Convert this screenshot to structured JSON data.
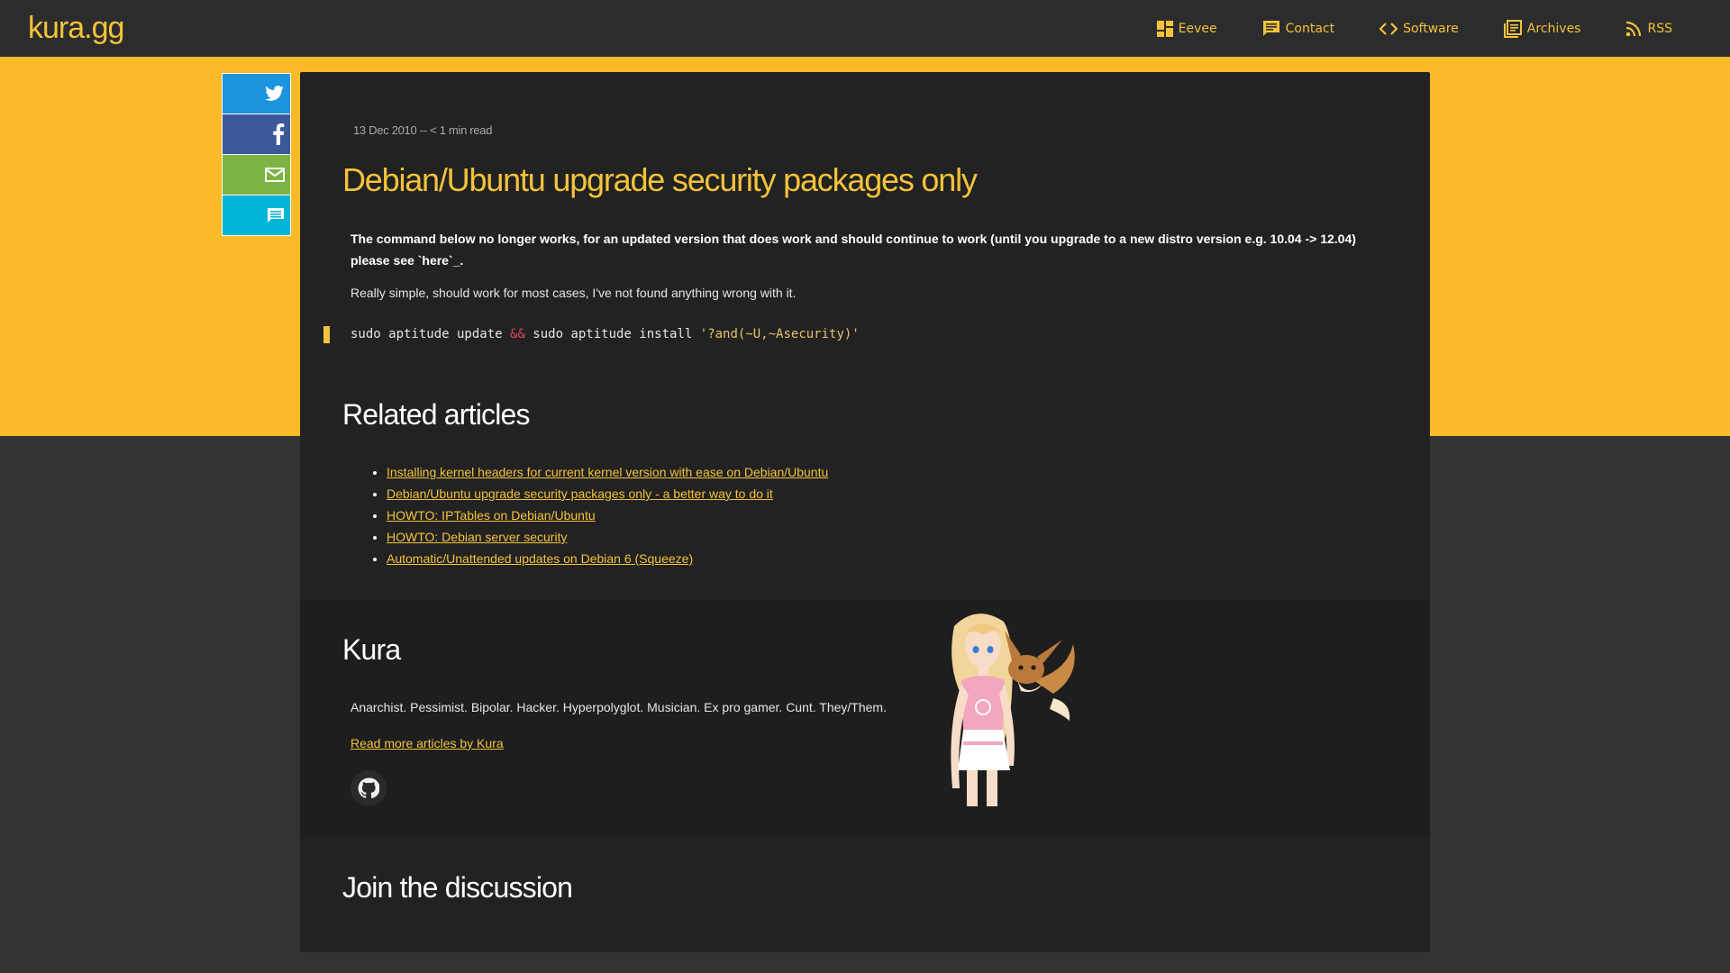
{
  "site": {
    "logo": "kura.gg"
  },
  "nav": [
    {
      "icon": "dashboard-icon",
      "label": "Eevee"
    },
    {
      "icon": "chat-icon",
      "label": "Contact"
    },
    {
      "icon": "code-icon",
      "label": "Software"
    },
    {
      "icon": "archive-icon",
      "label": "Archives"
    },
    {
      "icon": "rss-icon",
      "label": "RSS"
    }
  ],
  "share": [
    {
      "icon": "twitter-icon",
      "color": "#1b95e0"
    },
    {
      "icon": "facebook-icon",
      "color": "#3b5998"
    },
    {
      "icon": "mail-icon",
      "color": "#7cb342"
    },
    {
      "icon": "comment-icon",
      "color": "#00b6d6"
    }
  ],
  "article": {
    "meta": "13 Dec 2010 -- < 1 min read",
    "title": "Debian/Ubuntu upgrade security packages only",
    "notice": "The command below no longer works, for an updated version that does work and should continue to work (until you upgrade to a new distro version e.g. 10.04 -> 12.04) please see `here`_.",
    "paragraph": "Really simple, should work for most cases, I've not found anything wrong with it.",
    "code": {
      "part1": "sudo aptitude update ",
      "operator": "&&",
      "part2": " sudo aptitude install ",
      "string": "'?and(~U,~Asecurity)'"
    }
  },
  "related": {
    "heading": "Related articles",
    "items": [
      "Installing kernel headers for current kernel version with ease on Debian/Ubuntu",
      "Debian/Ubuntu upgrade security packages only - a better way to do it",
      "HOWTO: IPTables on Debian/Ubuntu",
      "HOWTO: Debian server security",
      "Automatic/Unattended updates on Debian 6 (Squeeze)"
    ]
  },
  "author": {
    "name": "Kura",
    "bio": "Anarchist. Pessimist. Bipolar. Hacker. Hyperpolyglot. Musician. Ex pro gamer. Cunt. They/Them.",
    "link": "Read more articles by Kura",
    "github_icon": "github-icon"
  },
  "discussion": {
    "heading": "Join the discussion"
  },
  "colors": {
    "accent": "#f3c33a",
    "band": "#fbbb28",
    "card": "#222222",
    "page": "#333333"
  }
}
